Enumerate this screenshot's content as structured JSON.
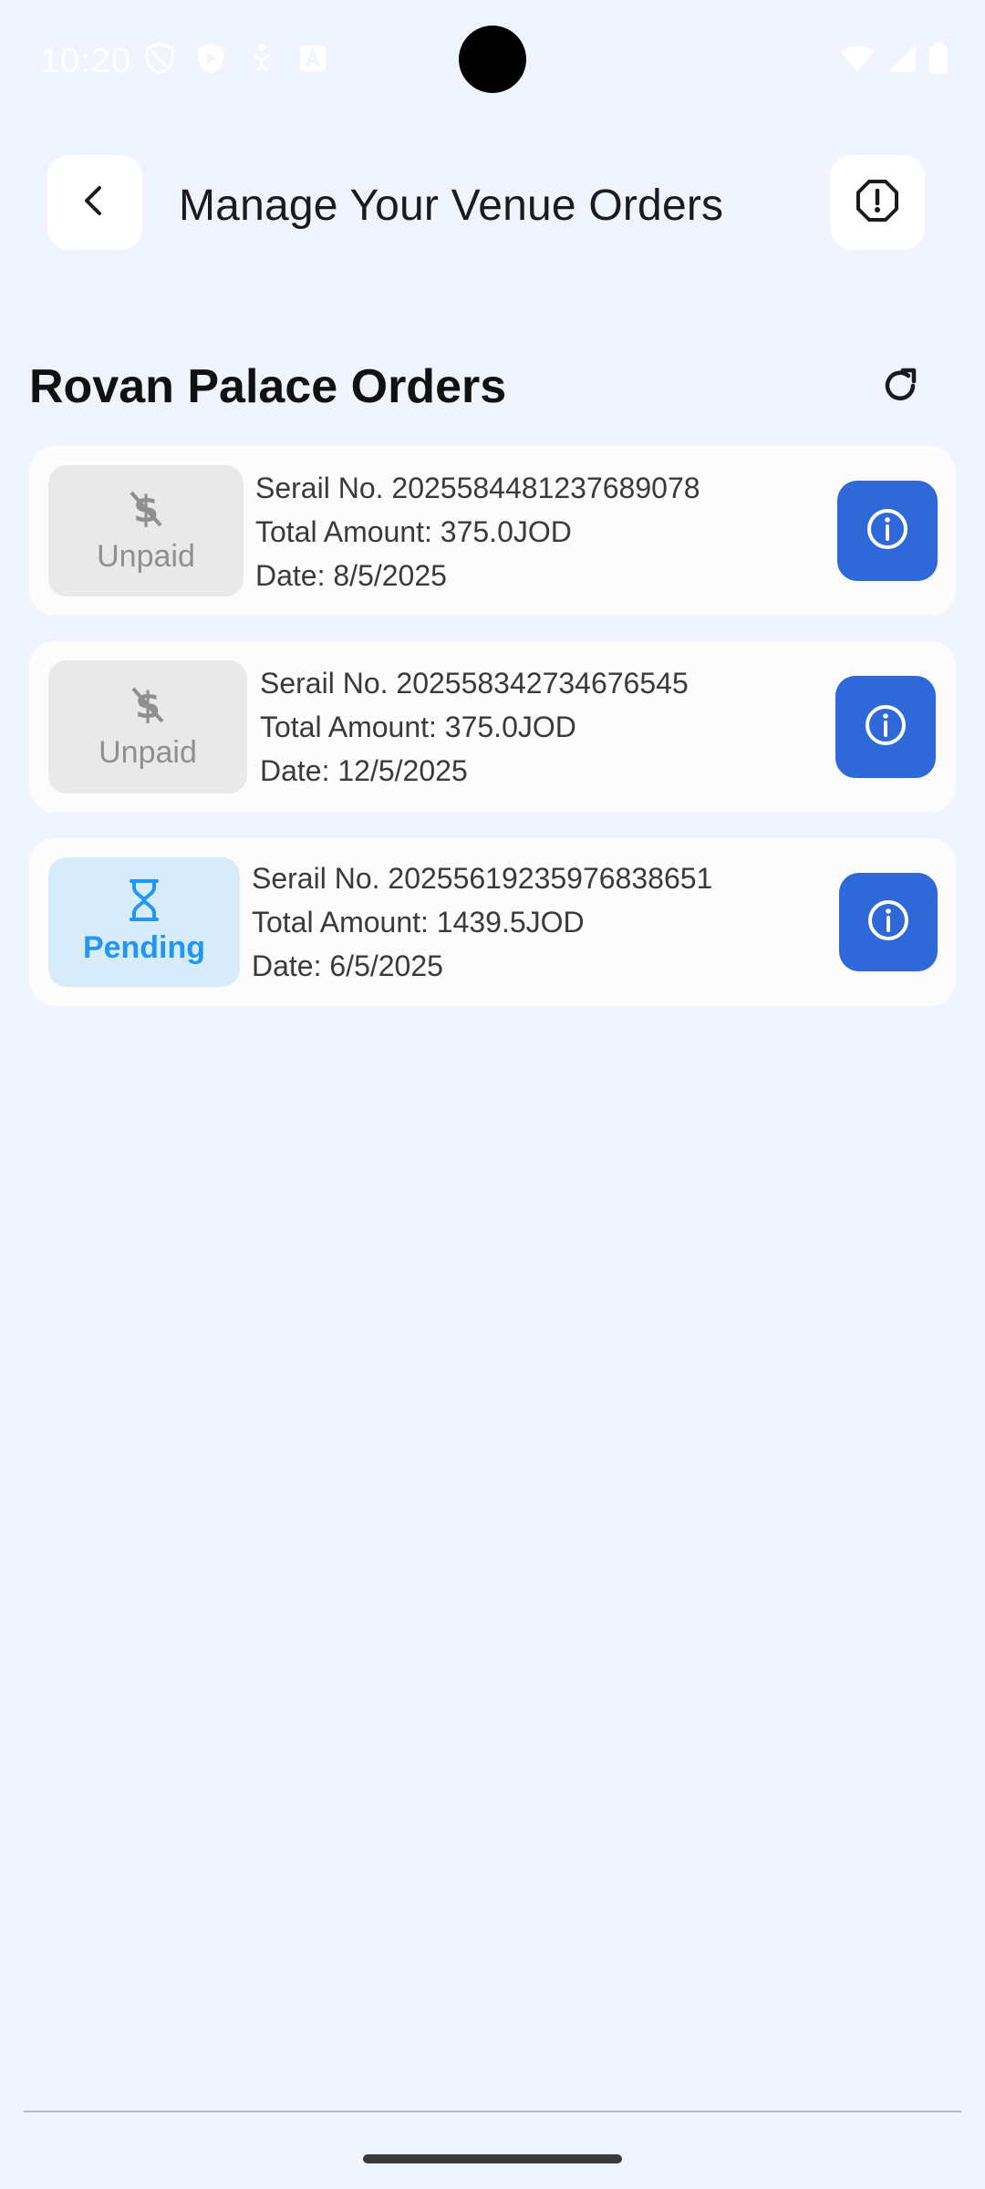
{
  "status_bar": {
    "time": "10:20",
    "icons_left": [
      "shield-icon",
      "vpn-icon",
      "accessibility-icon",
      "font-icon"
    ],
    "icons_right": [
      "wifi-icon",
      "signal-icon",
      "battery-icon"
    ]
  },
  "header": {
    "title": "Manage Your Venue Orders",
    "back_icon": "chevron-left-icon",
    "report_icon": "alert-octagon-icon"
  },
  "section": {
    "title": "Rovan Palace Orders",
    "refresh_icon": "refresh-icon"
  },
  "orders": [
    {
      "status": "Unpaid",
      "status_icon": "money-off-icon",
      "serial": "Serail No. 2025584481237689078",
      "total": "Total Amount: 375.0JOD",
      "date": "Date: 8/5/2025"
    },
    {
      "status": "Unpaid",
      "status_icon": "money-off-icon",
      "serial": "Serail No. 202558342734676545",
      "total": "Total Amount: 375.0JOD",
      "date": "Date: 12/5/2025"
    },
    {
      "status": "Pending",
      "status_icon": "hourglass-icon",
      "serial": "Serail No. 20255619235976838651",
      "total": "Total Amount: 1439.5JOD",
      "date": "Date: 6/5/2025"
    }
  ],
  "colors": {
    "background": "#eff4fe",
    "card": "#fcfcfd",
    "accent": "#2f68d8",
    "unpaid_badge": "#e9e9ea",
    "pending_badge": "#d7ebfa",
    "pending_text": "#2196f3"
  }
}
